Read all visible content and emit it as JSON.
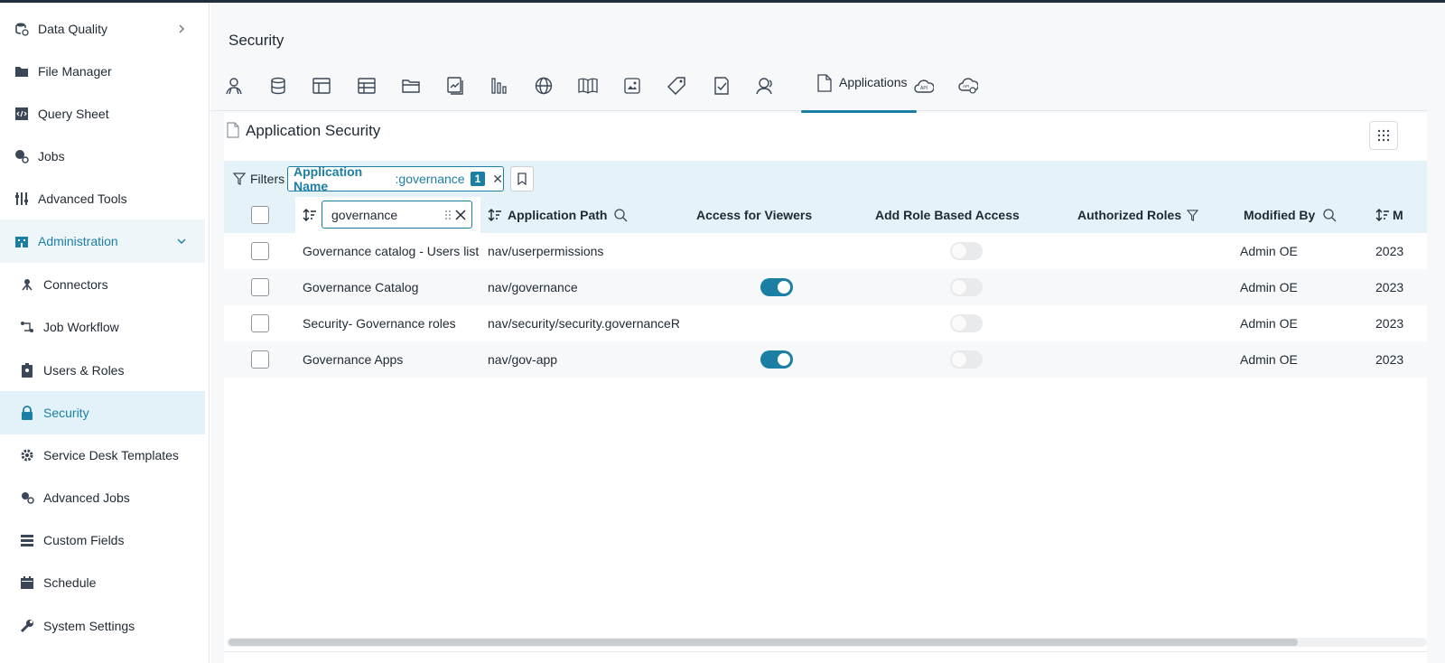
{
  "sidebar": {
    "items": [
      {
        "label": "Data Quality",
        "icon": "database-check-icon"
      },
      {
        "label": "File Manager",
        "icon": "folder-icon"
      },
      {
        "label": "Query Sheet",
        "icon": "code-sheet-icon"
      },
      {
        "label": "Jobs",
        "icon": "jobs-icon"
      },
      {
        "label": "Advanced Tools",
        "icon": "tools-icon"
      },
      {
        "label": "Administration",
        "icon": "building-icon"
      },
      {
        "label": "Connectors",
        "icon": "connectors-icon"
      },
      {
        "label": "Job Workflow",
        "icon": "workflow-icon"
      },
      {
        "label": "Users & Roles",
        "icon": "badge-icon"
      },
      {
        "label": "Security",
        "icon": "lock-icon"
      },
      {
        "label": "Service Desk Templates",
        "icon": "gear-icon"
      },
      {
        "label": "Advanced Jobs",
        "icon": "advanced-jobs-icon"
      },
      {
        "label": "Custom Fields",
        "icon": "fields-icon"
      },
      {
        "label": "Schedule",
        "icon": "calendar-icon"
      },
      {
        "label": "System Settings",
        "icon": "wrench-icon"
      }
    ]
  },
  "page": {
    "title": "Security"
  },
  "tabs": {
    "active_label": "Applications"
  },
  "panel": {
    "title": "Application Security"
  },
  "filters": {
    "label": "Filters",
    "chip_key": "Application Name",
    "chip_sep": ":",
    "chip_value": " governance",
    "chip_count": "1",
    "chip_close": "✕"
  },
  "table": {
    "name_filter_value": "governance",
    "headers": {
      "path": "Application Path",
      "viewers": "Access for Viewers",
      "role_based": "Add Role Based Access",
      "roles": "Authorized Roles",
      "modified_by": "Modified By",
      "modified_cut": "M"
    },
    "rows": [
      {
        "name": "Governance catalog - Users list",
        "path": "nav/userpermissions",
        "viewers": null,
        "role_based": false,
        "modified_by": "Admin OE",
        "date": "2023"
      },
      {
        "name": "Governance Catalog",
        "path": "nav/governance",
        "viewers": true,
        "role_based": false,
        "modified_by": "Admin OE",
        "date": "2023"
      },
      {
        "name": "Security- Governance roles",
        "path": "nav/security/security.governanceR",
        "viewers": null,
        "role_based": false,
        "modified_by": "Admin OE",
        "date": "2023"
      },
      {
        "name": "Governance Apps",
        "path": "nav/gov-app",
        "viewers": true,
        "role_based": false,
        "modified_by": "Admin OE",
        "date": "2023"
      }
    ]
  },
  "colors": {
    "accent": "#1b7fa3",
    "header_bg": "#e5f3f8",
    "nav_dark": "#1f2d3d"
  }
}
